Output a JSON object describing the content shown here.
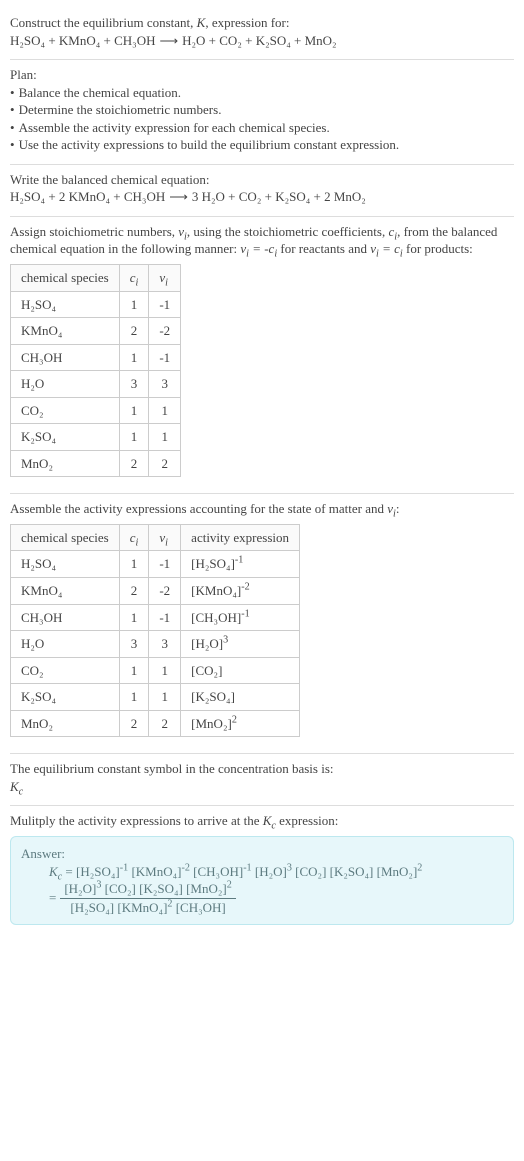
{
  "intro": {
    "line1_pre": "Construct the equilibrium constant, ",
    "line1_post": ", expression for:",
    "eq": {
      "lhs": "H₂SO₄ + KMnO₄ + CH₃OH",
      "arrow": "⟶",
      "rhs": "H₂O + CO₂ + K₂SO₄ + MnO₂"
    }
  },
  "plan": {
    "title": "Plan:",
    "items": [
      "Balance the chemical equation.",
      "Determine the stoichiometric numbers.",
      "Assemble the activity expression for each chemical species.",
      "Use the activity expressions to build the equilibrium constant expression."
    ]
  },
  "balanced": {
    "title": "Write the balanced chemical equation:",
    "eq": {
      "lhs": "H₂SO₄ + 2 KMnO₄ + CH₃OH",
      "arrow": "⟶",
      "rhs": "3 H₂O + CO₂ + K₂SO₄ + 2 MnO₂"
    }
  },
  "stoich": {
    "text_a": "Assign stoichiometric numbers, ",
    "text_b": ", using the stoichiometric coefficients, ",
    "text_c": ", from the balanced chemical equation in the following manner: ",
    "text_d": " for reactants and ",
    "text_e": " for products:",
    "headers": {
      "h1": "chemical species"
    },
    "rows": [
      {
        "species": "H₂SO₄",
        "c": "1",
        "v": "-1"
      },
      {
        "species": "KMnO₄",
        "c": "2",
        "v": "-2"
      },
      {
        "species": "CH₃OH",
        "c": "1",
        "v": "-1"
      },
      {
        "species": "H₂O",
        "c": "3",
        "v": "3"
      },
      {
        "species": "CO₂",
        "c": "1",
        "v": "1"
      },
      {
        "species": "K₂SO₄",
        "c": "1",
        "v": "1"
      },
      {
        "species": "MnO₂",
        "c": "2",
        "v": "2"
      }
    ]
  },
  "activity": {
    "title_a": "Assemble the activity expressions accounting for the state of matter and ",
    "title_b": ":",
    "headers": {
      "h1": "chemical species",
      "h4": "activity expression"
    },
    "rows": [
      {
        "species": "H₂SO₄",
        "c": "1",
        "v": "-1",
        "base": "[H₂SO₄]",
        "exp": "-1"
      },
      {
        "species": "KMnO₄",
        "c": "2",
        "v": "-2",
        "base": "[KMnO₄]",
        "exp": "-2"
      },
      {
        "species": "CH₃OH",
        "c": "1",
        "v": "-1",
        "base": "[CH₃OH]",
        "exp": "-1"
      },
      {
        "species": "H₂O",
        "c": "3",
        "v": "3",
        "base": "[H₂O]",
        "exp": "3"
      },
      {
        "species": "CO₂",
        "c": "1",
        "v": "1",
        "base": "[CO₂]",
        "exp": ""
      },
      {
        "species": "K₂SO₄",
        "c": "1",
        "v": "1",
        "base": "[K₂SO₄]",
        "exp": ""
      },
      {
        "species": "MnO₂",
        "c": "2",
        "v": "2",
        "base": "[MnO₂]",
        "exp": "2"
      }
    ]
  },
  "conc": {
    "line1": "The equilibrium constant symbol in the concentration basis is:"
  },
  "final": {
    "title_a": "Mulitply the activity expressions to arrive at the ",
    "title_b": " expression:",
    "answer_label": "Answer:"
  }
}
